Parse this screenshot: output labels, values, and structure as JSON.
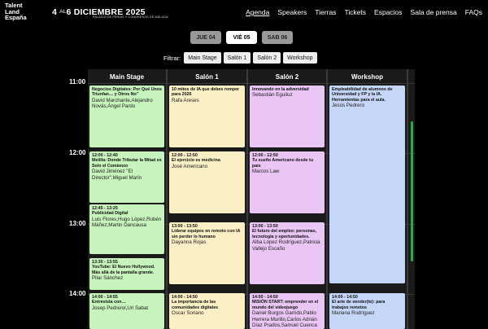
{
  "header": {
    "logo_line1": "Talent",
    "logo_line2": "Land",
    "logo_line3": "España",
    "date_start": "4",
    "date_sep": "AL",
    "date_end": "6",
    "date_month": "DICIEMBRE 2025",
    "venue": "PALACIO DE FERIAS Y CONGRESOS DE MÁLAGA",
    "nav": [
      "Agenda",
      "Speakers",
      "Tierras",
      "Tickets",
      "Espacios",
      "Sala de prensa",
      "FAQs"
    ]
  },
  "days": [
    "JUE 04",
    "VIÉ 05",
    "SAB 06"
  ],
  "active_day": "VIÉ 05",
  "filter": {
    "label": "Filtrar:",
    "chips": [
      "Main Stage",
      "Salón 1",
      "Salón 2",
      "Workshop"
    ]
  },
  "times": [
    "11:00",
    "12:00",
    "13:00",
    "14:00"
  ],
  "columns": [
    "Main Stage",
    "Salón 1",
    "Salón 2",
    "Workshop"
  ],
  "events": {
    "main": [
      {
        "time": "",
        "title": "Negocios Digitales: Por Qué Unos Triunfan… y Otros No\"",
        "speakers": "David Marchante,Alejandro Novás,Ángel Pardo"
      },
      {
        "time": "12:00 - 12:40",
        "title": "Melilla: Donde Tributar la Mitad es Solo el Comienzo",
        "speakers": "David Jiménez \"El Director\",Miguel Marín"
      },
      {
        "time": "12:45 - 13:25",
        "title": "Publicidad Digital",
        "speakers": "Luis Flores,Hugo López,Rubén Máñez,Martin Dancausa"
      },
      {
        "time": "13:30 - 13:55",
        "title": "YouTube: El Nuevo Hollywood. Más allá de la pantalla grande.",
        "speakers": "Pilar Sánchez"
      },
      {
        "time": "14:00 - 14:55",
        "title": "Entrevista con…",
        "speakers": "Josep Pedrerol,Uri Sabat"
      }
    ],
    "salon1": [
      {
        "time": "",
        "title": "10 mitos de IA que debes romper para 2026",
        "speakers": "Rafa Areses"
      },
      {
        "time": "12:00 - 12:50",
        "title": "El ejercicio es medicina",
        "speakers": "José Americano"
      },
      {
        "time": "13:00 - 13:50",
        "title": "Liderar equipos en remoto con IA sin perder lo humano",
        "speakers": "Dayanna Rojas"
      },
      {
        "time": "14:00 - 14:50",
        "title": "La importancia de las comunidades digitales",
        "speakers": "Oscar Soriano"
      }
    ],
    "salon2": [
      {
        "time": "",
        "title": "Innovando en la adversidad",
        "speakers": "Sebastián Eguiluz"
      },
      {
        "time": "12:00 - 12:50",
        "title": "Tu sueño Americano desde tu país",
        "speakers": "Marcos Law"
      },
      {
        "time": "13:00 - 13:50",
        "title": "El futuro del empleo: personas, tecnología y oportunidades.",
        "speakers": "Alba López Rodríguez,Patricia Vallejo Escaño"
      },
      {
        "time": "14:00 - 14:50",
        "title": "MISIÓN START: emprender en el mundo del videojuego",
        "speakers": "Daniel Burgos Garrido,Pablo Herrera Murillo,Carlos Adrián Díaz Prados,Samuel Cuenca"
      }
    ],
    "workshop": [
      {
        "time": "",
        "title": "Empleabilidad de alumnos de Universidad y FP y la IA. Herramientas para el aula.",
        "speakers": "Jesús Pedrero"
      },
      {
        "time": "14:00 - 14:50",
        "title": "El arte de vender(te): para trabajos remotos",
        "speakers": "Mariana Rodríguez"
      }
    ]
  }
}
